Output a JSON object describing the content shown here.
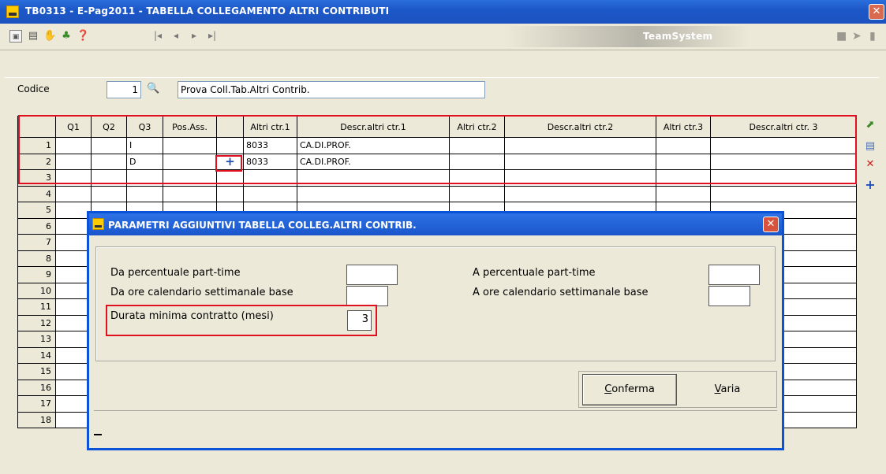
{
  "window": {
    "title": "TB0313  - E-Pag2011  -  TABELLA COLLEGAMENTO ALTRI CONTRIBUTI",
    "close": "✕"
  },
  "toolbar": {
    "brand": "TeamSystem",
    "nav": [
      "|◂",
      "◂",
      "▸",
      "▸|"
    ]
  },
  "header": {
    "codice_label": "Codice",
    "codice_value": "1",
    "descrizione_value": "Prova Coll.Tab.Altri Contrib."
  },
  "grid": {
    "columns": [
      "Q1",
      "Q2",
      "Q3",
      "Pos.Ass.",
      "",
      "Altri ctr.1",
      "Descr.altri ctr.1",
      "Altri ctr.2",
      "Descr.altri ctr.2",
      "Altri ctr.3",
      "Descr.altri ctr. 3"
    ],
    "rows": [
      {
        "n": "1",
        "cells": [
          "",
          "",
          "I",
          "",
          "",
          "8033",
          "CA.DI.PROF.",
          "",
          "",
          "",
          ""
        ]
      },
      {
        "n": "2",
        "cells": [
          "",
          "",
          "D",
          "",
          "+",
          "8033",
          "CA.DI.PROF.",
          "",
          "",
          "",
          ""
        ]
      },
      {
        "n": "3",
        "cells": [
          "",
          "",
          "",
          "",
          "",
          "",
          "",
          "",
          "",
          "",
          ""
        ]
      },
      {
        "n": "4",
        "cells": [
          "",
          "",
          "",
          "",
          "",
          "",
          "",
          "",
          "",
          "",
          ""
        ]
      },
      {
        "n": "5",
        "cells": [
          "",
          "",
          "",
          "",
          "",
          "",
          "",
          "",
          "",
          "",
          ""
        ]
      },
      {
        "n": "6",
        "cells": [
          "",
          "",
          "",
          "",
          "",
          "",
          "",
          "",
          "",
          "",
          ""
        ]
      },
      {
        "n": "7",
        "cells": [
          "",
          "",
          "",
          "",
          "",
          "",
          "",
          "",
          "",
          "",
          ""
        ]
      },
      {
        "n": "8",
        "cells": [
          "",
          "",
          "",
          "",
          "",
          "",
          "",
          "",
          "",
          "",
          ""
        ]
      },
      {
        "n": "9",
        "cells": [
          "",
          "",
          "",
          "",
          "",
          "",
          "",
          "",
          "",
          "",
          ""
        ]
      },
      {
        "n": "10",
        "cells": [
          "",
          "",
          "",
          "",
          "",
          "",
          "",
          "",
          "",
          "",
          ""
        ]
      },
      {
        "n": "11",
        "cells": [
          "",
          "",
          "",
          "",
          "",
          "",
          "",
          "",
          "",
          "",
          ""
        ]
      },
      {
        "n": "12",
        "cells": [
          "",
          "",
          "",
          "",
          "",
          "",
          "",
          "",
          "",
          "",
          ""
        ]
      },
      {
        "n": "13",
        "cells": [
          "",
          "",
          "",
          "",
          "",
          "",
          "",
          "",
          "",
          "",
          ""
        ]
      },
      {
        "n": "14",
        "cells": [
          "",
          "",
          "",
          "",
          "",
          "",
          "",
          "",
          "",
          "",
          ""
        ]
      },
      {
        "n": "15",
        "cells": [
          "",
          "",
          "",
          "",
          "",
          "",
          "",
          "",
          "",
          "",
          ""
        ]
      },
      {
        "n": "16",
        "cells": [
          "",
          "",
          "",
          "",
          "",
          "",
          "",
          "",
          "",
          "",
          ""
        ]
      },
      {
        "n": "17",
        "cells": [
          "",
          "",
          "",
          "",
          "",
          "",
          "",
          "",
          "",
          "",
          ""
        ]
      },
      {
        "n": "18",
        "cells": [
          "",
          "",
          "",
          "",
          "",
          "",
          "",
          "",
          "",
          "",
          ""
        ]
      }
    ]
  },
  "dialog": {
    "title": "PARAMETRI AGGIUNTIVI TABELLA COLLEG.ALTRI CONTRIB.",
    "close": "✕",
    "fields": {
      "da_perc_label": "Da percentuale part-time",
      "da_perc_value": "",
      "da_ore_label": "Da ore calendario settimanale base",
      "da_ore_value": "",
      "durata_label": "Durata minima contratto (mesi)",
      "durata_value": "3",
      "a_perc_label": "A percentuale part-time",
      "a_perc_value": "",
      "a_ore_label": "A ore calendario settimanale base",
      "a_ore_value": ""
    },
    "buttons": {
      "conferma_first": "C",
      "conferma_rest": "onferma",
      "varia_first": "V",
      "varia_rest": "aria"
    }
  },
  "colors": {
    "highlight": "#e01020",
    "titlebar": "#1d58c8",
    "window_bg": "#ece9d8"
  }
}
